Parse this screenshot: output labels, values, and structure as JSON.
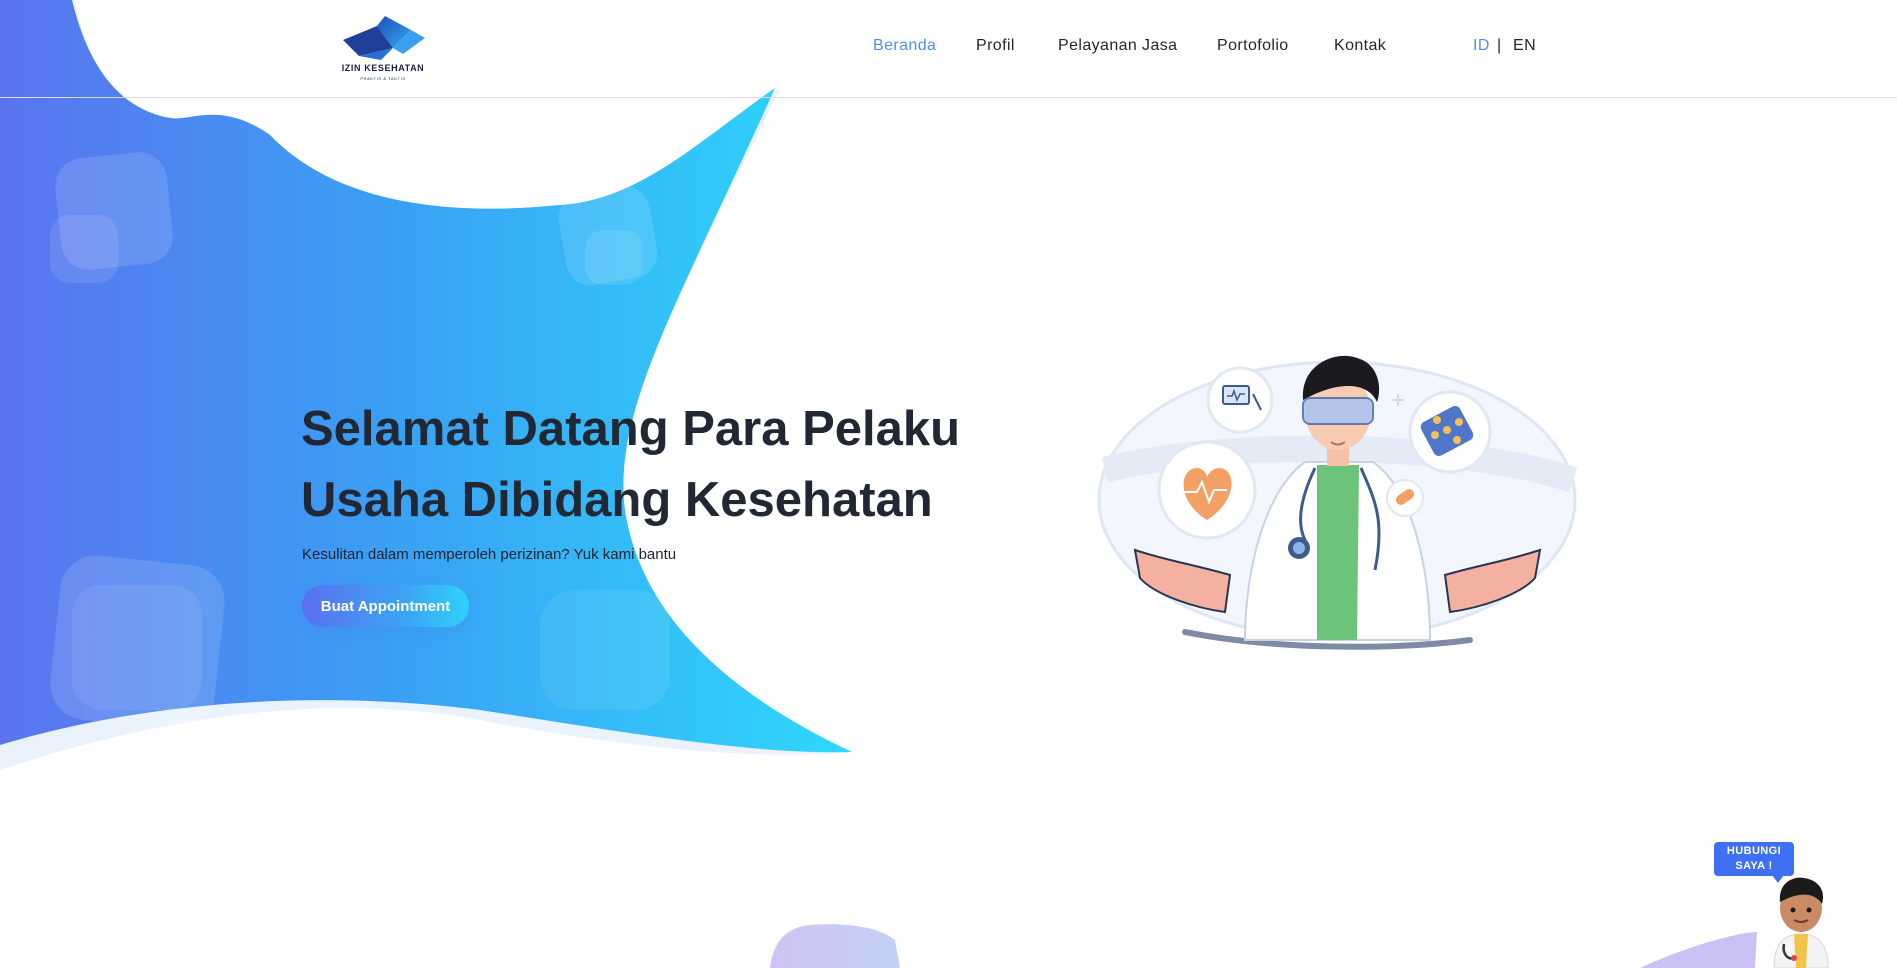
{
  "brand": {
    "logo_name": "IZIN KESEHATAN",
    "logo_sub": "PRAKTIS & TAKTIS",
    "colors": {
      "primary_blue": "#4f8ff0",
      "gradient_start": "#5b6ff0",
      "gradient_end": "#2fd1fb",
      "text_dark": "#222833"
    }
  },
  "nav": {
    "items": [
      {
        "label": "Beranda",
        "active": true
      },
      {
        "label": "Profil",
        "active": false
      },
      {
        "label": "Pelayanan Jasa",
        "active": false
      },
      {
        "label": "Portofolio",
        "active": false
      },
      {
        "label": "Kontak",
        "active": false
      }
    ],
    "languages": [
      {
        "label": "ID",
        "active": true
      },
      {
        "label": "EN",
        "active": false
      }
    ],
    "lang_separator": "|"
  },
  "hero": {
    "title_line1": "Selamat Datang Para Pelaku",
    "title_line2": "Usaha Dibidang Kesehatan",
    "subtitle": "Kesulitan dalam memperoleh perizinan? Yuk kami bantu",
    "cta_label": "Buat Appointment",
    "illustration": "doctor-illustration"
  },
  "contact_widget": {
    "line1": "HUBUNGI",
    "line2": "SAYA !",
    "icon": "doctor-avatar-icon"
  }
}
